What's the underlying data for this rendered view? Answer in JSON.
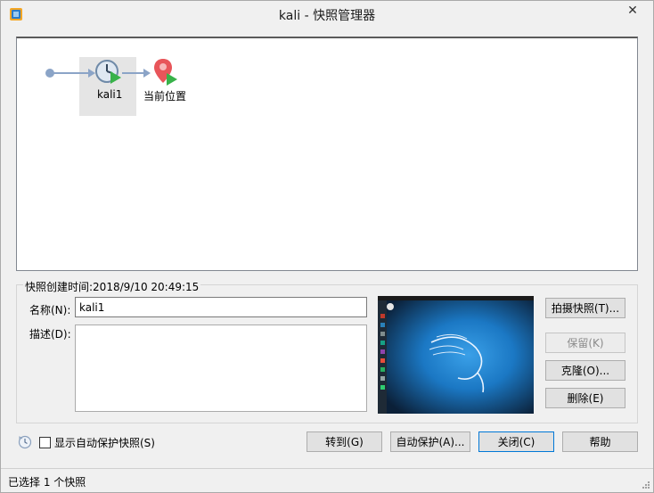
{
  "window": {
    "title": "kali - 快照管理器",
    "close_symbol": "✕"
  },
  "tree": {
    "nodes": [
      {
        "label": "kali1",
        "icon": "snapshot-clock-icon",
        "selected": true
      },
      {
        "label": "当前位置",
        "icon": "current-location-pin-icon",
        "selected": false
      }
    ]
  },
  "details": {
    "created_time": "快照创建时间:2018/9/10 20:49:15",
    "name_label": "名称(N):",
    "name_value": "kali1",
    "desc_label": "描述(D):",
    "desc_value": ""
  },
  "actions": {
    "take_snapshot": "拍摄快照(T)...",
    "keep": "保留(K)",
    "clone": "克隆(O)...",
    "delete": "删除(E)"
  },
  "footer": {
    "show_autoprotect": "显示自动保护快照(S)",
    "goto": "转到(G)",
    "autoprotect": "自动保护(A)...",
    "close": "关闭(C)",
    "help": "帮助"
  },
  "status": {
    "text": "已选择 1 个快照"
  },
  "colors": {
    "accent": "#0078d7",
    "connector": "#8ba4c7",
    "pin": "#e8555a",
    "play": "#38b249",
    "thumb_blue": "#1b78c4"
  }
}
